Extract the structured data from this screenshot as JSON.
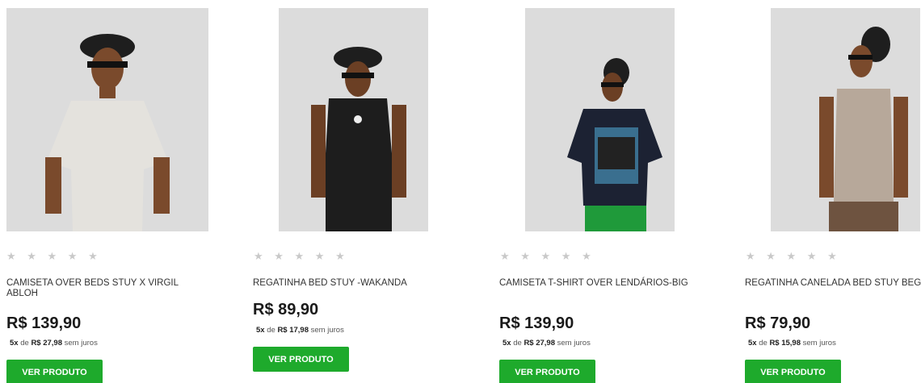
{
  "rating_glyphs": "★ ★ ★ ★ ★",
  "button_label": "VER PRODUTO",
  "installment_prefix": "5x",
  "installment_de": "de",
  "installment_suffix": "sem juros",
  "colors": {
    "button": "#1eaa2c",
    "photo_bg": "#dcdcdc",
    "star": "#c9c9c9"
  },
  "products": [
    {
      "name": "CAMISETA OVER BEDS STUY X VIRGIL ABLOH",
      "price": "R$ 139,90",
      "installment_value": "R$ 27,98"
    },
    {
      "name": "REGATINHA BED STUY -WAKANDA",
      "price": "R$ 89,90",
      "installment_value": "R$ 17,98"
    },
    {
      "name": "CAMISETA T-SHIRT OVER LENDÁRIOS-BIG",
      "price": "R$ 139,90",
      "installment_value": "R$ 27,98"
    },
    {
      "name": "REGATINHA CANELADA BED STUY BEGE",
      "price": "R$ 79,90",
      "installment_value": "R$ 15,98"
    }
  ]
}
